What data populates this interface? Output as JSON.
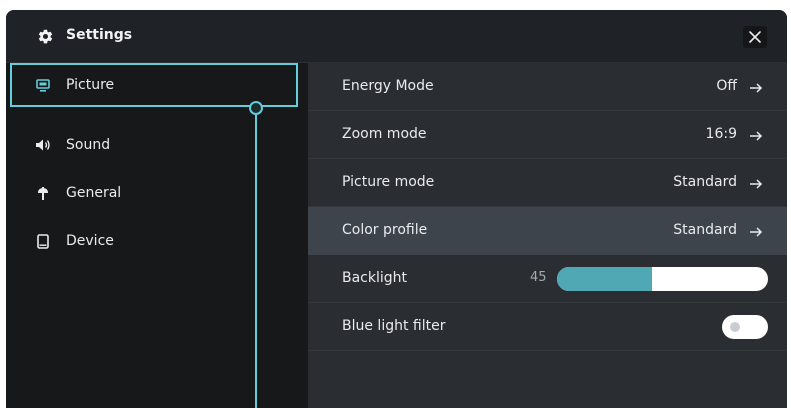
{
  "window": {
    "title": "Settings",
    "title_icon": "gear-icon",
    "close_icon": "close-icon"
  },
  "sidebar": {
    "items": [
      {
        "label": "Picture",
        "icon": "monitor-icon",
        "active": true
      },
      {
        "label": "Sound",
        "icon": "speaker-icon",
        "active": false
      },
      {
        "label": "General",
        "icon": "lamp-icon",
        "active": false
      },
      {
        "label": "Device",
        "icon": "tablet-icon",
        "active": false
      }
    ]
  },
  "settings": {
    "energy_mode": {
      "label": "Energy Mode",
      "value": "Off"
    },
    "zoom_mode": {
      "label": "Zoom mode",
      "value": "16:9"
    },
    "picture_mode": {
      "label": "Picture mode",
      "value": "Standard"
    },
    "color_profile": {
      "label": "Color profile",
      "value": "Standard",
      "highlighted": true
    },
    "backlight": {
      "label": "Backlight",
      "value": "45",
      "level_percent": 45
    },
    "blue_light_filter": {
      "label": "Blue light filter",
      "enabled": false
    }
  },
  "colors": {
    "accent": "#63cdd9",
    "slider_fill": "#4fa8b4",
    "panel_bg": "#2a2e33",
    "sidebar_bg": "#161819",
    "highlight_bg": "#3e444b"
  }
}
